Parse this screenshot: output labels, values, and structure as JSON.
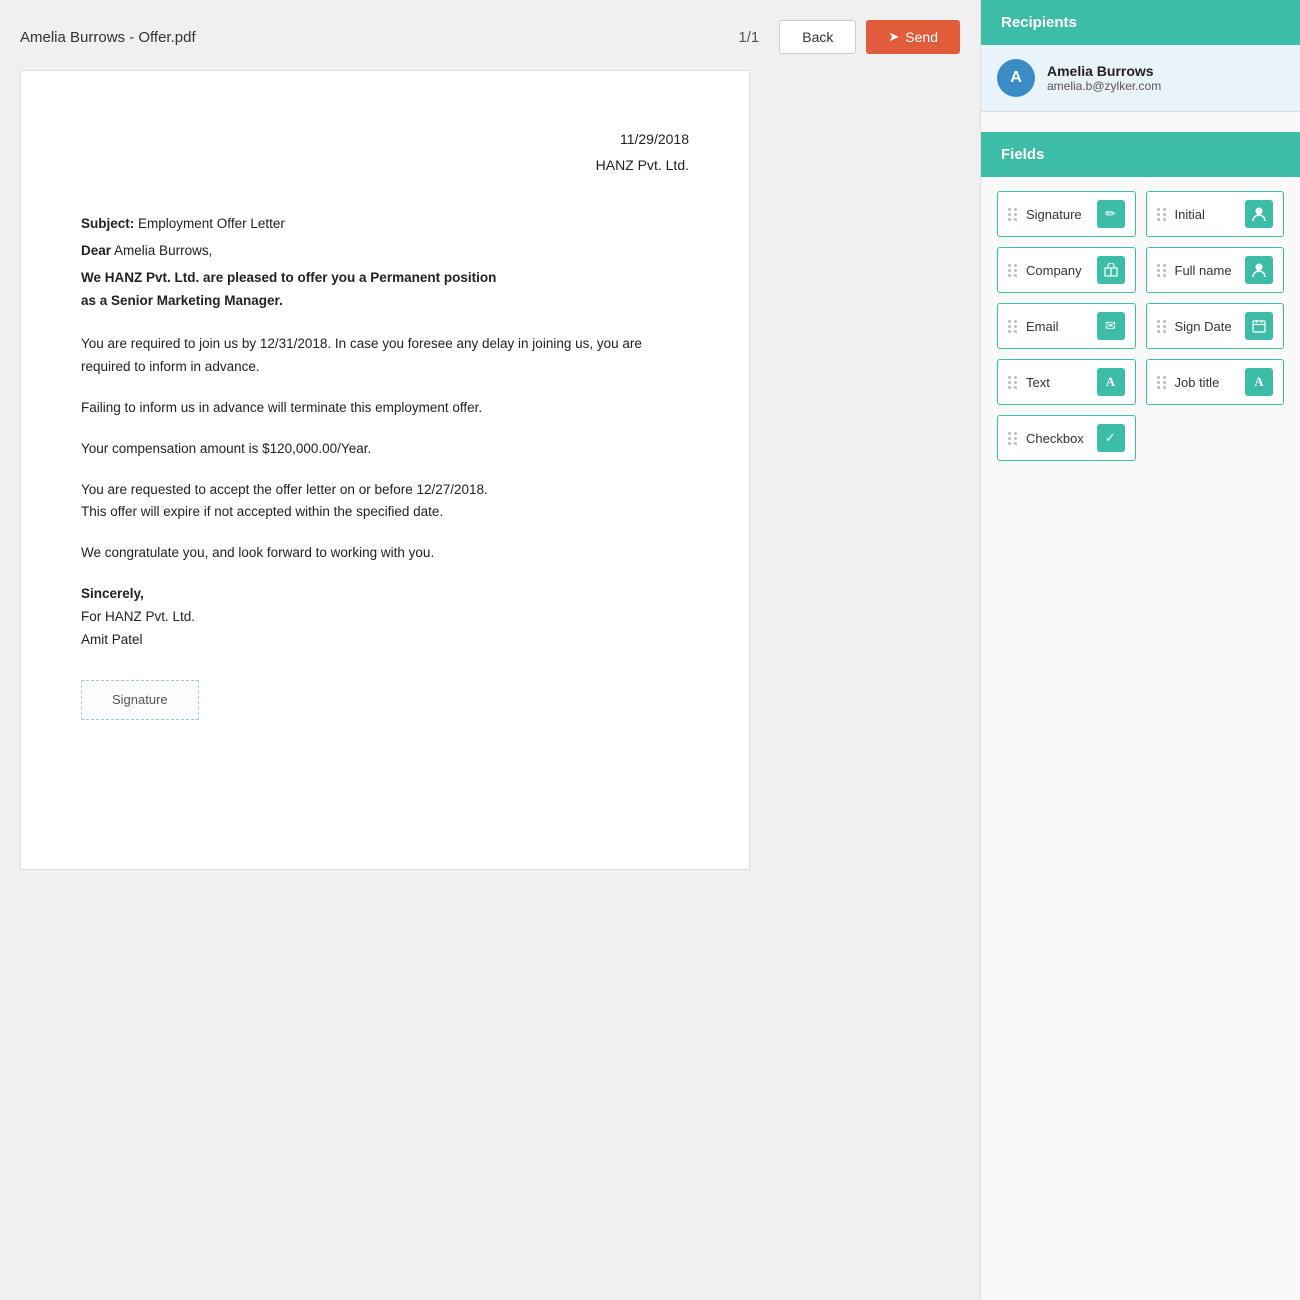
{
  "toolbar": {
    "filename": "Amelia Burrows - Offer.pdf",
    "page": "1/1",
    "back_label": "Back",
    "send_label": "Send",
    "send_icon": "➤"
  },
  "document": {
    "date": "11/29/2018",
    "company": "HANZ Pvt. Ltd.",
    "subject_label": "Subject:",
    "subject_text": "Employment Offer Letter",
    "dear_label": "Dear",
    "dear_name": "Amelia Burrows,",
    "offer_line1": "We HANZ Pvt. Ltd. are pleased to offer you a Permanent position",
    "offer_line2": "as a Senior Marketing Manager.",
    "para1": "You are required to join us by 12/31/2018. In case you foresee any delay in joining us, you are required to inform in advance.",
    "para2": "Failing to inform us in advance will terminate this employment offer.",
    "para3": "Your compensation amount is $120,000.00/Year.",
    "para4_line1": "You are requested to accept the offer letter on or before 12/27/2018.",
    "para4_line2": "This offer will expire if not accepted within the specified date.",
    "para5": "We congratulate you, and look forward to working with you.",
    "closing1": "Sincerely,",
    "closing2": "For HANZ Pvt. Ltd.",
    "closing3": "Amit Patel",
    "signature_placeholder": "Signature"
  },
  "recipients": {
    "header": "Recipients",
    "items": [
      {
        "initial": "A",
        "name": "Amelia Burrows",
        "email": "amelia.b@zylker.com"
      }
    ]
  },
  "fields": {
    "header": "Fields",
    "items": [
      {
        "label": "Signature",
        "icon": "✏",
        "col": 1
      },
      {
        "label": "Initial",
        "icon": "👤",
        "col": 2
      },
      {
        "label": "Company",
        "icon": "🏢",
        "col": 1
      },
      {
        "label": "Full name",
        "icon": "👤",
        "col": 2
      },
      {
        "label": "Email",
        "icon": "✉",
        "col": 1
      },
      {
        "label": "Sign Date",
        "icon": "📅",
        "col": 2
      },
      {
        "label": "Text",
        "icon": "A",
        "col": 1
      },
      {
        "label": "Job title",
        "icon": "A",
        "col": 2
      },
      {
        "label": "Checkbox",
        "icon": "✓",
        "col": 1
      }
    ]
  }
}
